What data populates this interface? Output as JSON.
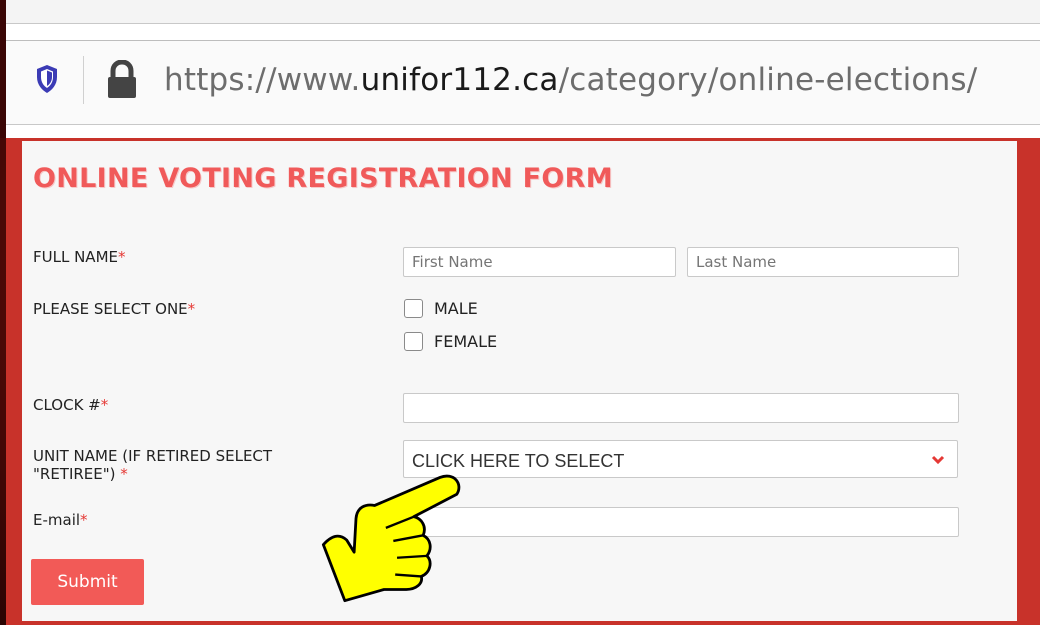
{
  "browser": {
    "url_prefix": "https://www.",
    "url_host": "unifor112.ca",
    "url_path": "/category/online-elections/",
    "icons": [
      "shield-icon",
      "lock-icon"
    ]
  },
  "form": {
    "title": "ONLINE VOTING REGISTRATION FORM",
    "required_marker": "*",
    "full_name": {
      "label": "FULL NAME",
      "first_placeholder": "First Name",
      "last_placeholder": "Last Name"
    },
    "gender": {
      "label": "PLEASE SELECT ONE",
      "options": [
        "MALE",
        "FEMALE"
      ]
    },
    "clock": {
      "label": "CLOCK #",
      "value": ""
    },
    "unit": {
      "label_line1": "UNIT NAME (IF RETIRED SELECT",
      "label_line2": "\"RETIREE\")",
      "selected": "CLICK HERE TO SELECT"
    },
    "email": {
      "label": "E-mail",
      "value": ""
    },
    "submit_label": "Submit"
  },
  "colors": {
    "page_red": "#c8322a",
    "title_red": "#f05a5a",
    "button_red": "#f25a57",
    "pointer_yellow": "#ffff00"
  },
  "annotation": {
    "icon": "pointing-hand-icon"
  }
}
